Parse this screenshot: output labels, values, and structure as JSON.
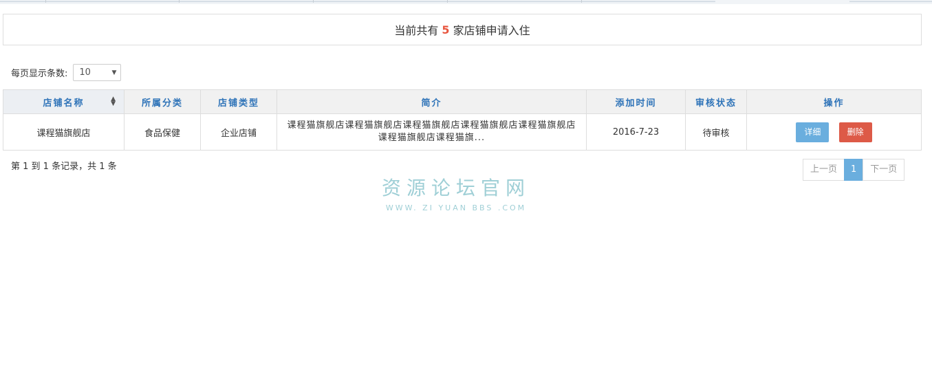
{
  "summary": {
    "prefix": "当前共有",
    "count": "5",
    "suffix": "家店铺申请入住"
  },
  "page_size": {
    "label": "每页显示条数:",
    "value": "10"
  },
  "table": {
    "columns": [
      "店铺名称",
      "所属分类",
      "店铺类型",
      "简介",
      "添加时间",
      "审核状态",
      "操作"
    ],
    "rows": [
      {
        "name": "课程猫旗舰店",
        "category": "食品保健",
        "type": "企业店铺",
        "intro": "课程猫旗舰店课程猫旗舰店课程猫旗舰店课程猫旗舰店课程猫旗舰店课程猫旗舰店课程猫旗...",
        "added": "2016-7-23",
        "status": "待审核",
        "detail_label": "详细",
        "delete_label": "删除"
      }
    ]
  },
  "records_text": "第 1 到 1 条记录，共 1 条",
  "pager": {
    "prev": "上一页",
    "current": "1",
    "next": "下一页"
  },
  "watermark": {
    "title": "资源论坛官网",
    "url": "WWW. ZI YUAN BBS .COM"
  }
}
